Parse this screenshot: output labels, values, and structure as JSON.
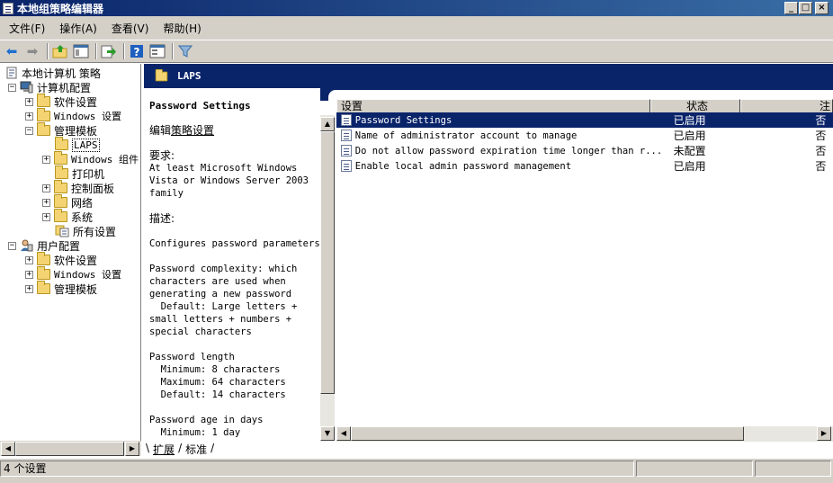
{
  "window": {
    "title": "本地组策略编辑器",
    "btn_min": "_",
    "btn_max": "□",
    "btn_close": "×"
  },
  "menu": [
    "文件(F)",
    "操作(A)",
    "查看(V)",
    "帮助(H)"
  ],
  "toolbar_icons": [
    "back-icon",
    "forward-icon",
    "up-folder-icon",
    "show-hide-tree-icon",
    "export-list-icon",
    "help-icon",
    "properties-icon",
    "filter-icon"
  ],
  "tree": [
    {
      "label": "本地计算机 策略",
      "exp": "",
      "icon": "policy-doc"
    },
    {
      "label": "计算机配置",
      "exp": "−",
      "icon": "computer"
    },
    {
      "label": "软件设置",
      "exp": "+",
      "icon": "folder"
    },
    {
      "label": "Windows 设置",
      "exp": "+",
      "icon": "folder"
    },
    {
      "label": "管理模板",
      "exp": "−",
      "icon": "folder"
    },
    {
      "label": "LAPS",
      "exp": "",
      "icon": "folder",
      "selected": true
    },
    {
      "label": "Windows 组件",
      "exp": "+",
      "icon": "folder"
    },
    {
      "label": "打印机",
      "exp": "",
      "icon": "folder"
    },
    {
      "label": "控制面板",
      "exp": "+",
      "icon": "folder"
    },
    {
      "label": "网络",
      "exp": "+",
      "icon": "folder"
    },
    {
      "label": "系统",
      "exp": "+",
      "icon": "folder"
    },
    {
      "label": "所有设置",
      "exp": "",
      "icon": "all-settings"
    },
    {
      "label": "用户配置",
      "exp": "−",
      "icon": "user"
    },
    {
      "label": "软件设置",
      "exp": "+",
      "icon": "folder"
    },
    {
      "label": "Windows 设置",
      "exp": "+",
      "icon": "folder"
    },
    {
      "label": "管理模板",
      "exp": "+",
      "icon": "folder"
    }
  ],
  "banner": {
    "title": "LAPS"
  },
  "desc": {
    "heading": "Password Settings",
    "edit_prefix": "编辑",
    "edit_link": "策略设置",
    "req_label": "要求:",
    "req_text": "At least Microsoft Windows\nVista or Windows Server 2003\nfamily",
    "desc_label": "描述:",
    "p1": "Configures password parameters",
    "p2": "Password complexity: which\ncharacters are used when\ngenerating a new password\n  Default: Large letters +\nsmall letters + numbers +\nspecial characters",
    "p3": "Password length\n  Minimum: 8 characters\n  Maximum: 64 characters\n  Default: 14 characters",
    "p4": "Password age in days\n  Minimum: 1 day"
  },
  "columns": {
    "setting": "设置",
    "state": "状态",
    "comment": "注"
  },
  "rows": [
    {
      "name": "Password Settings",
      "state": "已启用",
      "comment": "否",
      "selected": true
    },
    {
      "name": "Name of administrator account to manage",
      "state": "已启用",
      "comment": "否"
    },
    {
      "name": "Do not allow password expiration time longer than r...",
      "state": "未配置",
      "comment": "否"
    },
    {
      "name": "Enable local admin password management",
      "state": "已启用",
      "comment": "否"
    }
  ],
  "tabs": {
    "extended": "扩展",
    "standard": "标准"
  },
  "status": {
    "count": "4 个设置"
  }
}
